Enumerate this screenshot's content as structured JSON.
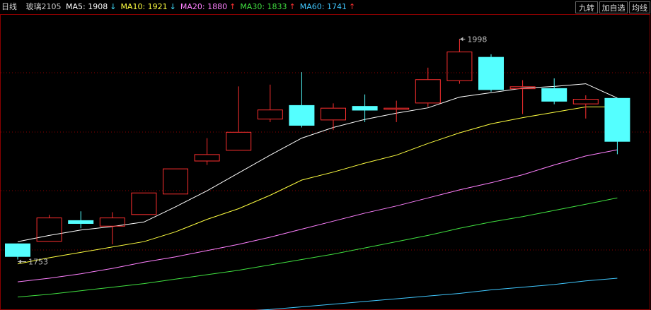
{
  "header": {
    "period": "日线",
    "symbol": "玻璃2105",
    "ma": [
      {
        "label": "MA5: ",
        "value": "1908",
        "arrow": "↓",
        "color": "#ffffff"
      },
      {
        "label": "MA10: ",
        "value": "1921",
        "arrow": "↓",
        "color": "#ffff40"
      },
      {
        "label": "MA20: ",
        "value": "1880",
        "arrow": "↑",
        "color": "#ff80ff"
      },
      {
        "label": "MA30: ",
        "value": "1833",
        "arrow": "↑",
        "color": "#40e040"
      },
      {
        "label": "MA60: ",
        "value": "1741",
        "arrow": "↑",
        "color": "#40c8ff"
      }
    ],
    "arrow_colors": {
      "up": "#ff3030",
      "down": "#40e0ff"
    }
  },
  "buttons": {
    "jiuzhuan": "九转",
    "add_watch": "加自选",
    "ma_lines": "均线"
  },
  "annotations": {
    "high": "1998",
    "low": "1753"
  },
  "chart_data": {
    "type": "candlestick",
    "ylim": [
      1695,
      2025
    ],
    "candles": [
      {
        "o": 1768,
        "c": 1753,
        "h": 1768,
        "l": 1750
      },
      {
        "o": 1770,
        "c": 1797,
        "h": 1800,
        "l": 1770
      },
      {
        "o": 1794,
        "c": 1790,
        "h": 1804,
        "l": 1785
      },
      {
        "o": 1787,
        "c": 1797,
        "h": 1803,
        "l": 1767
      },
      {
        "o": 1800,
        "c": 1825,
        "h": 1825,
        "l": 1800
      },
      {
        "o": 1823,
        "c": 1852,
        "h": 1852,
        "l": 1823
      },
      {
        "o": 1860,
        "c": 1868,
        "h": 1886,
        "l": 1856
      },
      {
        "o": 1872,
        "c": 1893,
        "h": 1944,
        "l": 1872
      },
      {
        "o": 1907,
        "c": 1918,
        "h": 1946,
        "l": 1904
      },
      {
        "o": 1923,
        "c": 1900,
        "h": 1960,
        "l": 1898
      },
      {
        "o": 1906,
        "c": 1920,
        "h": 1925,
        "l": 1895
      },
      {
        "o": 1922,
        "c": 1917,
        "h": 1935,
        "l": 1904
      },
      {
        "o": 1918,
        "c": 1920,
        "h": 1928,
        "l": 1904
      },
      {
        "o": 1925,
        "c": 1952,
        "h": 1965,
        "l": 1921
      },
      {
        "o": 1950,
        "c": 1983,
        "h": 1997,
        "l": 1947
      },
      {
        "o": 1977,
        "c": 1940,
        "h": 1980,
        "l": 1938
      },
      {
        "o": 1941,
        "c": 1944,
        "h": 1951,
        "l": 1913
      },
      {
        "o": 1942,
        "c": 1927,
        "h": 1953,
        "l": 1924
      },
      {
        "o": 1924,
        "c": 1930,
        "h": 1934,
        "l": 1908
      },
      {
        "o": 1931,
        "c": 1882,
        "h": 1931,
        "l": 1868
      }
    ],
    "ma_lines": [
      {
        "name": "MA5",
        "color": "#ffffff",
        "values": [
          1770,
          1777,
          1783,
          1787,
          1792,
          1809,
          1827,
          1847,
          1867,
          1886,
          1898,
          1907,
          1914,
          1920,
          1932,
          1937,
          1942,
          1944,
          1947,
          1931
        ]
      },
      {
        "name": "MA10",
        "color": "#ffff40",
        "values": [
          1745,
          1752,
          1758,
          1764,
          1770,
          1781,
          1795,
          1807,
          1822,
          1839,
          1848,
          1858,
          1867,
          1880,
          1892,
          1902,
          1909,
          1915,
          1921,
          1921
        ]
      },
      {
        "name": "MA20",
        "color": "#ff80ff",
        "values": [
          1725,
          1729,
          1734,
          1740,
          1747,
          1753,
          1760,
          1767,
          1775,
          1784,
          1793,
          1802,
          1810,
          1819,
          1828,
          1836,
          1845,
          1856,
          1866,
          1873
        ]
      },
      {
        "name": "MA30",
        "color": "#40e040",
        "values": [
          1708,
          1711,
          1715,
          1719,
          1723,
          1728,
          1733,
          1738,
          1744,
          1750,
          1756,
          1763,
          1770,
          1777,
          1785,
          1792,
          1798,
          1805,
          1812,
          1819
        ]
      },
      {
        "name": "MA60",
        "color": "#40c8ff",
        "values": [
          1682,
          1683,
          1684,
          1686,
          1687,
          1688,
          1690,
          1692,
          1694,
          1697,
          1700,
          1703,
          1706,
          1709,
          1712,
          1716,
          1719,
          1722,
          1726,
          1729
        ]
      }
    ],
    "high_index": 14,
    "low_index": 0,
    "colors": {
      "up": "#ff3030",
      "down": "#54ffff",
      "grid": "#8b0000"
    }
  }
}
